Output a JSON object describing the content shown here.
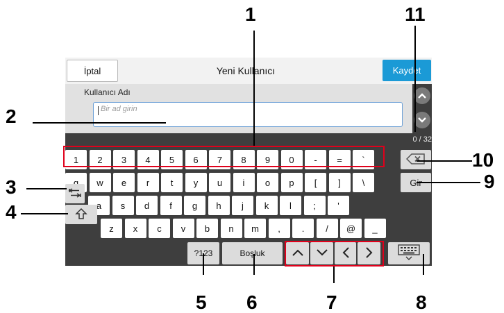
{
  "header": {
    "cancel_label": "İptal",
    "title": "Yeni Kullanıcı",
    "save_label": "Kaydet"
  },
  "form": {
    "field_label": "Kullanıcı Adı",
    "placeholder": "Bir ad girin",
    "counter": "0 / 32"
  },
  "keyboard": {
    "row1": [
      "1",
      "2",
      "3",
      "4",
      "5",
      "6",
      "7",
      "8",
      "9",
      "0",
      "-",
      "=",
      "`"
    ],
    "row2": [
      "q",
      "w",
      "e",
      "r",
      "t",
      "y",
      "u",
      "i",
      "o",
      "p",
      "[",
      "]",
      "\\"
    ],
    "row3": [
      "a",
      "s",
      "d",
      "f",
      "g",
      "h",
      "j",
      "k",
      "l",
      ";",
      "'"
    ],
    "row4": [
      "z",
      "x",
      "c",
      "v",
      "b",
      "n",
      "m",
      ",",
      ".",
      "/",
      "@",
      "_"
    ],
    "enter_label": "Gir",
    "numsym_label": "?123",
    "space_label": "Boşluk"
  },
  "icons": {
    "backspace": "backspace-icon",
    "shift": "shift-icon",
    "tab": "tab-icon",
    "up": "arrow-up-icon",
    "down": "arrow-down-icon",
    "left": "arrow-left-icon",
    "right": "arrow-right-icon",
    "keyboard": "keyboard-icon",
    "scroll_up": "scroll-up-icon",
    "scroll_down": "scroll-down-icon"
  },
  "callouts": [
    "1",
    "2",
    "3",
    "4",
    "5",
    "6",
    "7",
    "8",
    "9",
    "10",
    "11"
  ],
  "colors": {
    "accent": "#1b9ad6",
    "highlight": "#e0001b",
    "panel": "#3e3e3e"
  }
}
